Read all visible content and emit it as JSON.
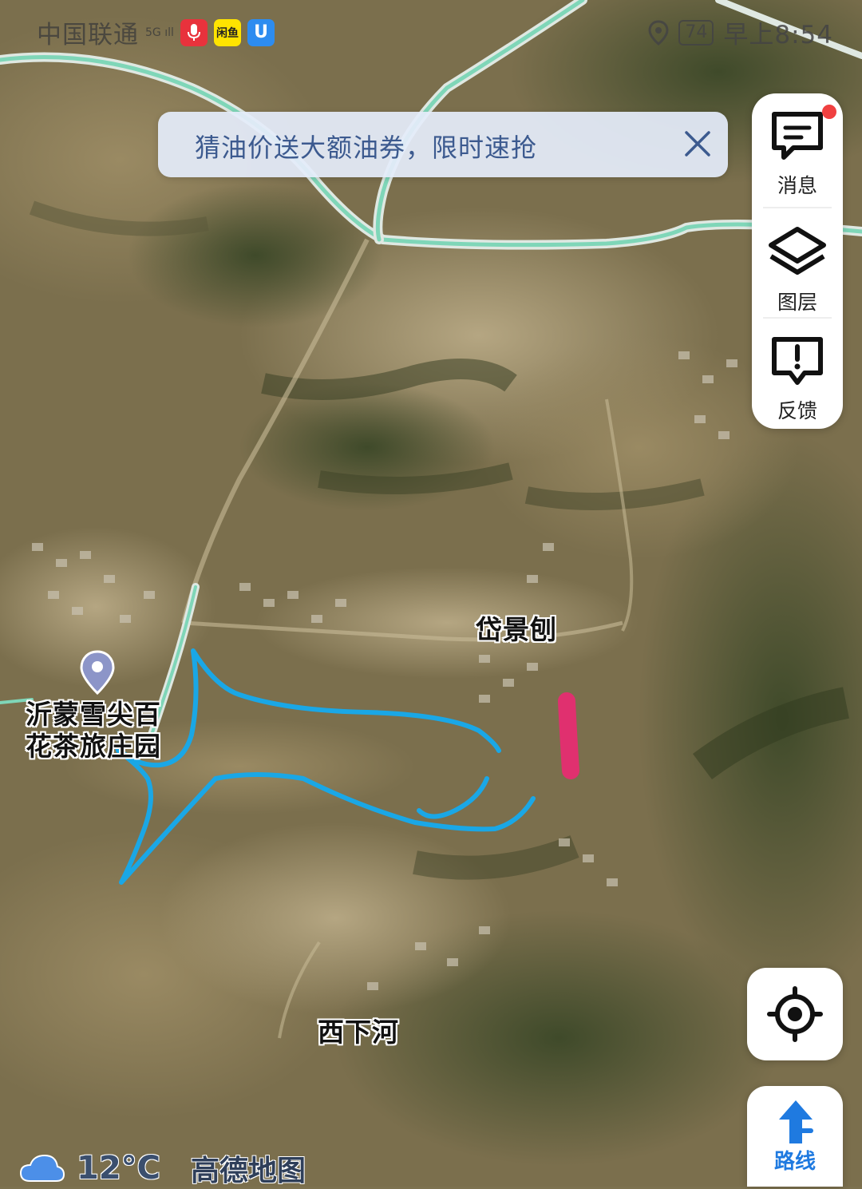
{
  "status_bar": {
    "carrier": "中国联通",
    "signal_text": "5G ıll",
    "app_icons": [
      "microphone-app-icon",
      "xianyu-app-icon",
      "u-app-icon"
    ],
    "app_icon_xianyu_text": "闲鱼",
    "app_icon_u_text": "U",
    "battery": "74",
    "time": "早上8:54"
  },
  "banner": {
    "text": "猜油价送大额油券，限时速抢"
  },
  "side_panel": {
    "items": [
      {
        "label": "消息",
        "icon": "message-icon",
        "has_badge": true
      },
      {
        "label": "图层",
        "icon": "layers-icon"
      },
      {
        "label": "反馈",
        "icon": "feedback-icon"
      }
    ]
  },
  "map": {
    "labels": {
      "village_main": "岱景刨",
      "village_south": "西下河",
      "poi_line1": "沂蒙雪尖百",
      "poi_line2": "花茶旅庄园"
    },
    "colors": {
      "road": "#7fd6b8",
      "drawn_outline": "#1aa7e6",
      "drawn_mark": "#e0306f"
    }
  },
  "controls": {
    "locate": "locate-icon",
    "route_label": "路线"
  },
  "bottom": {
    "weather_icon": "cloud-icon",
    "temperature": "12°C",
    "brand": "高德地图"
  }
}
